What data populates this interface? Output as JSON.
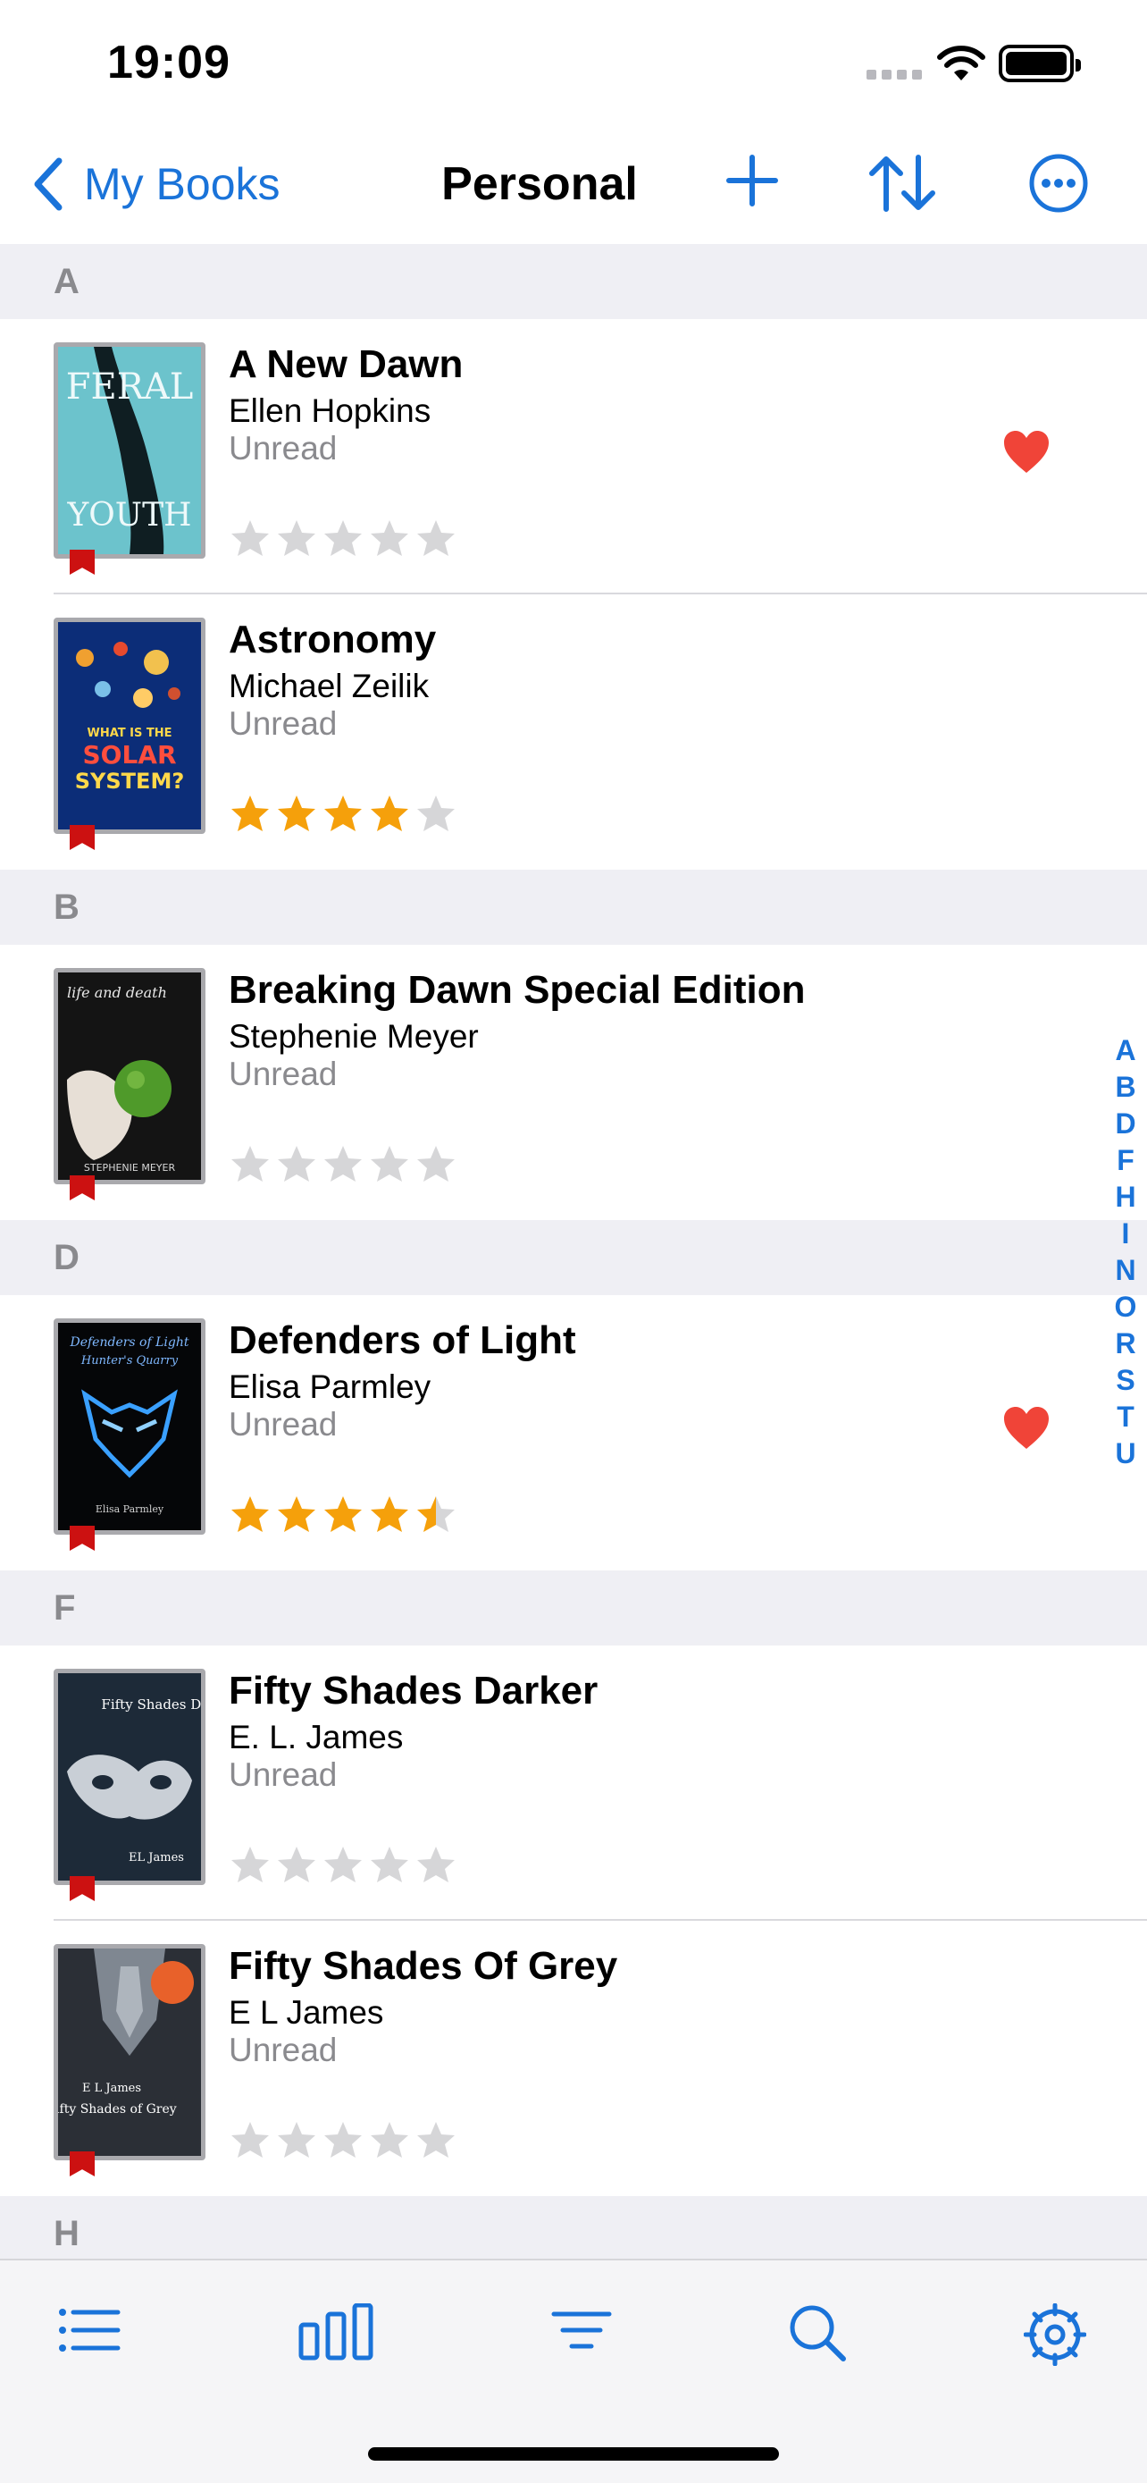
{
  "status_bar": {
    "time": "19:09"
  },
  "nav": {
    "back_label": "My Books",
    "title": "Personal"
  },
  "sections": [
    {
      "letter": "A",
      "books": [
        {
          "title": "A New Dawn",
          "author": "Ellen Hopkins",
          "status": "Unread",
          "rating": 0,
          "favorite": true
        },
        {
          "title": "Astronomy",
          "author": "Michael Zeilik",
          "status": "Unread",
          "rating": 4,
          "favorite": false
        }
      ]
    },
    {
      "letter": "B",
      "books": [
        {
          "title": "Breaking Dawn Special Edition",
          "author": "Stephenie Meyer",
          "status": "Unread",
          "rating": 0,
          "favorite": false
        }
      ]
    },
    {
      "letter": "D",
      "books": [
        {
          "title": "Defenders of Light",
          "author": "Elisa Parmley",
          "status": "Unread",
          "rating": 4.5,
          "favorite": true
        }
      ]
    },
    {
      "letter": "F",
      "books": [
        {
          "title": "Fifty Shades Darker",
          "author": "E. L. James",
          "status": "Unread",
          "rating": 0,
          "favorite": false
        },
        {
          "title": "Fifty Shades Of Grey",
          "author": "E L James",
          "status": "Unread",
          "rating": 0,
          "favorite": false
        }
      ]
    },
    {
      "letter": "H",
      "books": []
    }
  ],
  "index_letters": [
    "A",
    "B",
    "D",
    "F",
    "H",
    "I",
    "N",
    "O",
    "R",
    "S",
    "T",
    "U"
  ],
  "cover_text": {
    "feral_top": "FERAL",
    "feral_bottom": "YOUTH",
    "astronomy_line1": "WHAT IS THE",
    "astronomy_line2": "SOLAR",
    "astronomy_line3": "SYSTEM?",
    "twilight_top": "life and death",
    "twilight_bottom": "STEPHENIE MEYER",
    "defenders_title": "Defenders of Light",
    "defenders_subtitle": "Hunter's Quarry",
    "defenders_author": "Elisa Parmley",
    "darker_title": "Fifty Shades Darker",
    "darker_author": "EL James",
    "grey_author": "E L James",
    "grey_title": "Fifty Shades of Grey"
  },
  "colors": {
    "accent": "#1a73d9",
    "section_bg": "#efeff4",
    "star_filled": "#f5a00b",
    "star_empty": "#d6d6d8",
    "heart": "#f04438",
    "ribbon": "#cc1111"
  },
  "tabs": [
    {
      "icon": "list-icon"
    },
    {
      "icon": "stats-icon"
    },
    {
      "icon": "filter-icon"
    },
    {
      "icon": "search-icon"
    },
    {
      "icon": "settings-icon"
    }
  ]
}
